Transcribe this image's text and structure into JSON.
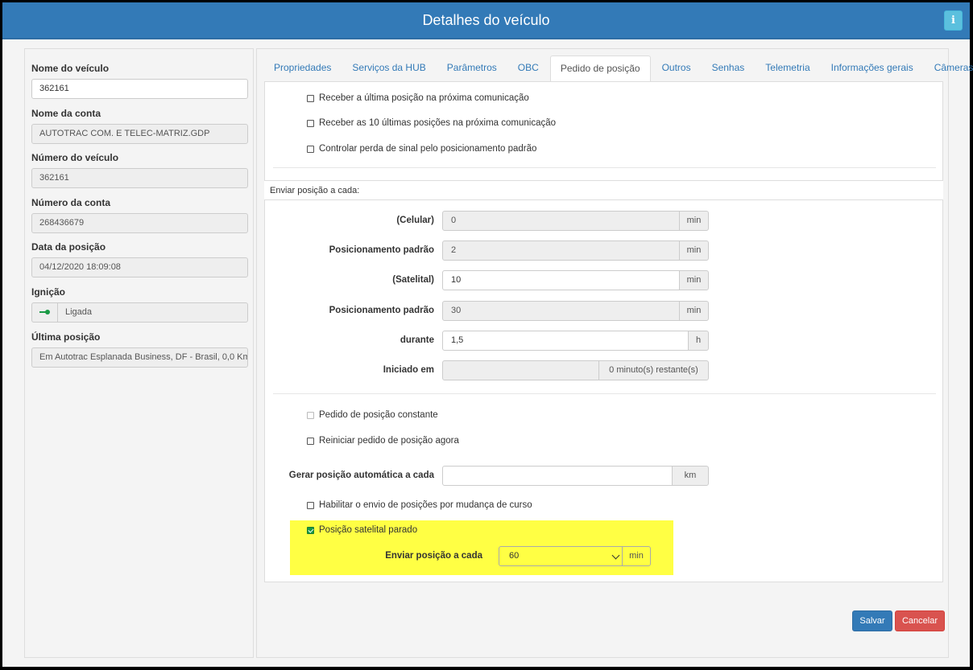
{
  "window": {
    "title": "Detalhes do veículo",
    "info_label": "i"
  },
  "left": {
    "fields": [
      {
        "label": "Nome do veículo",
        "value": "362161"
      },
      {
        "label": "Nome da conta",
        "value": "AUTOTRAC COM. E TELEC-MATRIZ.GDP"
      },
      {
        "label": "Número do veículo",
        "value": "362161"
      },
      {
        "label": "Número da conta",
        "value": "268436679"
      },
      {
        "label": "Data da posição",
        "value": "04/12/2020 18:09:08"
      },
      {
        "label": "Ignição",
        "value": "Ligada"
      },
      {
        "label": "Última posição",
        "value": "Em  Autotrac Esplanada Business, DF - Brasil, 0,0 Km"
      }
    ]
  },
  "tabs": [
    "Propriedades",
    "Serviços da HUB",
    "Parâmetros",
    "OBC",
    "Pedido de posição",
    "Outros",
    "Senhas",
    "Telemetria",
    "Informações gerais",
    "Câmeras"
  ],
  "active_tab": "Pedido de posição",
  "checks_top": [
    "Receber a última posição na próxima comunicação",
    "Receber as 10 últimas posições na próxima comunicação",
    "Controlar perda de sinal pelo posicionamento padrão"
  ],
  "section_title": "Enviar posição a cada:",
  "interval_rows": [
    {
      "label": "(Celular)",
      "value": "0",
      "unit": "min"
    },
    {
      "label": "Posicionamento padrão",
      "value": "2",
      "unit": "min"
    },
    {
      "label": "(Satelital)",
      "value": "10",
      "unit": "min"
    },
    {
      "label": "Posicionamento padrão",
      "value": "30",
      "unit": "min"
    },
    {
      "label": "durante",
      "value": "1,5",
      "unit": "h"
    },
    {
      "label": "Iniciado em",
      "value": "",
      "unit": "0 minuto(s) restante(s)"
    }
  ],
  "checks_mid": [
    "Pedido de posição constante",
    "Reiniciar pedido de posição agora"
  ],
  "auto_position": {
    "label": "Gerar posição automática a cada",
    "value": "",
    "unit": "km"
  },
  "course_change": "Habilitar o envio de posições por mudança de curso",
  "satellite_stopped": {
    "label": "Posição satelital parado",
    "send_label": "Enviar posição a cada",
    "selected": "60",
    "unit": "min"
  },
  "buttons": {
    "save": "Salvar",
    "cancel": "Cancelar"
  },
  "colors": {
    "header": "#337ab7",
    "highlight": "#ffff44",
    "checked": "#1a9a45",
    "cancel": "#d9534f"
  }
}
